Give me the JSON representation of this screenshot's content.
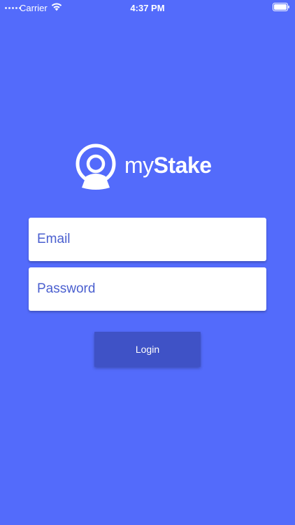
{
  "status_bar": {
    "carrier": "Carrier",
    "time": "4:37 PM",
    "icons": {
      "signal": "signal-dots-icon",
      "wifi": "wifi-icon",
      "battery": "battery-icon"
    }
  },
  "logo": {
    "text_light": "my",
    "text_bold": "Stake",
    "icon": "stake-logo-icon"
  },
  "form": {
    "email_placeholder": "Email",
    "password_placeholder": "Password",
    "login_label": "Login"
  },
  "colors": {
    "background": "#536bfb",
    "button": "#3f52c6",
    "field_text": "#4a5fcf"
  }
}
